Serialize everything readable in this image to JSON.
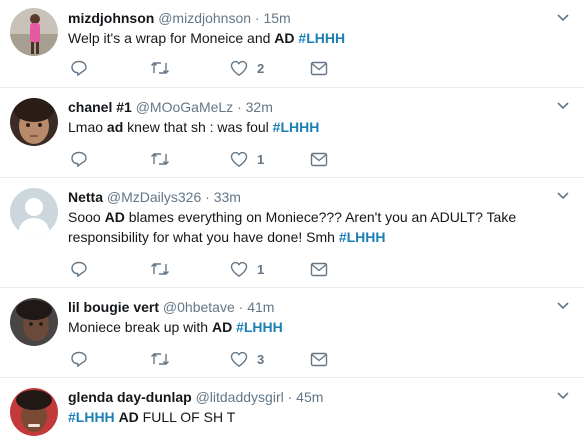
{
  "colors": {
    "hashtag": "#1b7fb6",
    "secondary_text": "#657786",
    "icon": "#657786",
    "divider": "#e6ecf0"
  },
  "tweets": [
    {
      "name": "mizdjohnson",
      "handle": "@mizdjohnson",
      "sep": "·",
      "time": "15m",
      "segments": [
        {
          "t": "Welp it's a wrap for Moneice and ",
          "s": "n"
        },
        {
          "t": "AD",
          "s": "b"
        },
        {
          "t": " ",
          "s": "n"
        },
        {
          "t": "#LHHH",
          "s": "tag"
        }
      ],
      "likes": "2"
    },
    {
      "name": "chanel #1",
      "handle": "@MOoGaMeLz",
      "sep": "·",
      "time": "32m",
      "segments": [
        {
          "t": "Lmao ",
          "s": "n"
        },
        {
          "t": "ad",
          "s": "b"
        },
        {
          "t": " knew that sh  : was foul  ",
          "s": "n"
        },
        {
          "t": "#LHHH",
          "s": "tag"
        }
      ],
      "likes": "1"
    },
    {
      "name": "Netta",
      "handle": "@MzDailys326",
      "sep": "·",
      "time": "33m",
      "segments": [
        {
          "t": "Sooo ",
          "s": "n"
        },
        {
          "t": "AD",
          "s": "b"
        },
        {
          "t": " blames everything on Moniece??? Aren't you an ADULT? Take responsibility for what you have done! Smh ",
          "s": "n"
        },
        {
          "t": "#LHHH",
          "s": "tag"
        }
      ],
      "likes": "1"
    },
    {
      "name": "lil bougie vert",
      "handle": "@0hbetave",
      "sep": "·",
      "time": "41m",
      "segments": [
        {
          "t": "Moniece break up with ",
          "s": "n"
        },
        {
          "t": "AD",
          "s": "b"
        },
        {
          "t": " ",
          "s": "n"
        },
        {
          "t": "#LHHH",
          "s": "tag"
        }
      ],
      "likes": "3"
    },
    {
      "name": "glenda day-dunlap",
      "handle": "@litdaddysgirl",
      "sep": "·",
      "time": "45m",
      "segments": [
        {
          "t": "#LHHH",
          "s": "tag"
        },
        {
          "t": " ",
          "s": "n"
        },
        {
          "t": "AD",
          "s": "b"
        },
        {
          "t": " FULL OF SH  T",
          "s": "n"
        }
      ],
      "likes": ""
    }
  ]
}
